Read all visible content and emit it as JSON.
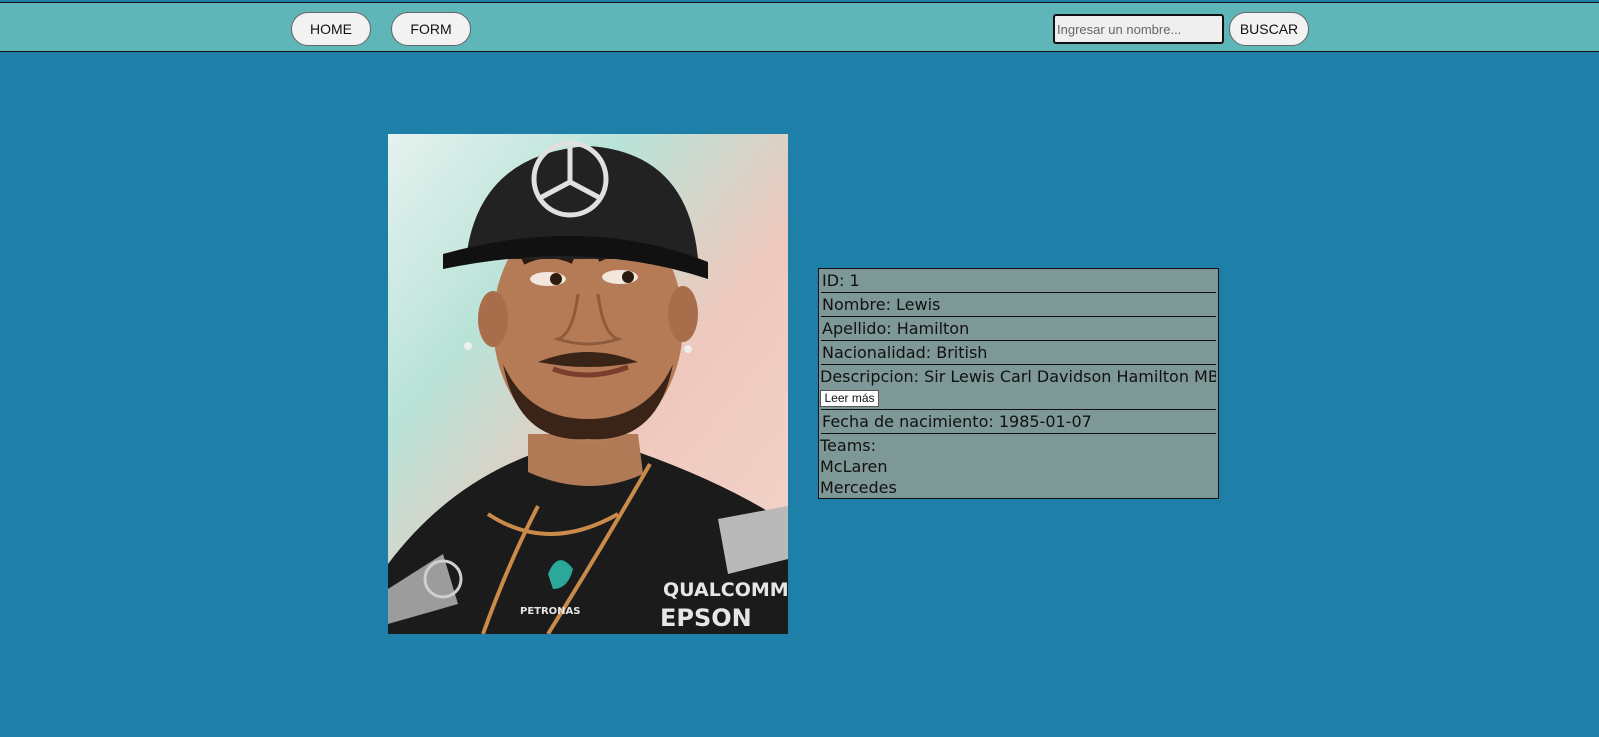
{
  "nav": {
    "home_label": "HOME",
    "form_label": "FORM",
    "search_placeholder": "Ingresar un nombre...",
    "search_label": "BUSCAR"
  },
  "driver": {
    "id": "ID: 1",
    "nombre": "Nombre: Lewis",
    "apellido": "Apellido: Hamilton",
    "nacionalidad": "Nacionalidad: British",
    "descripcion": "Descripcion: Sir Lewis Carl Davidson Hamilton MBE",
    "read_more_label": "Leer más",
    "fecha": "Fecha de nacimiento: 1985-01-07",
    "teams_label": "Teams:",
    "teams": [
      "McLaren",
      "Mercedes"
    ],
    "photo_logos": [
      "Mercedes star",
      "Petronas",
      "Qualcomm",
      "Epson"
    ]
  },
  "colors": {
    "page_background": "#1e80a8",
    "navbar_background": "#5fb6b8",
    "card_background": "#7e9898"
  }
}
